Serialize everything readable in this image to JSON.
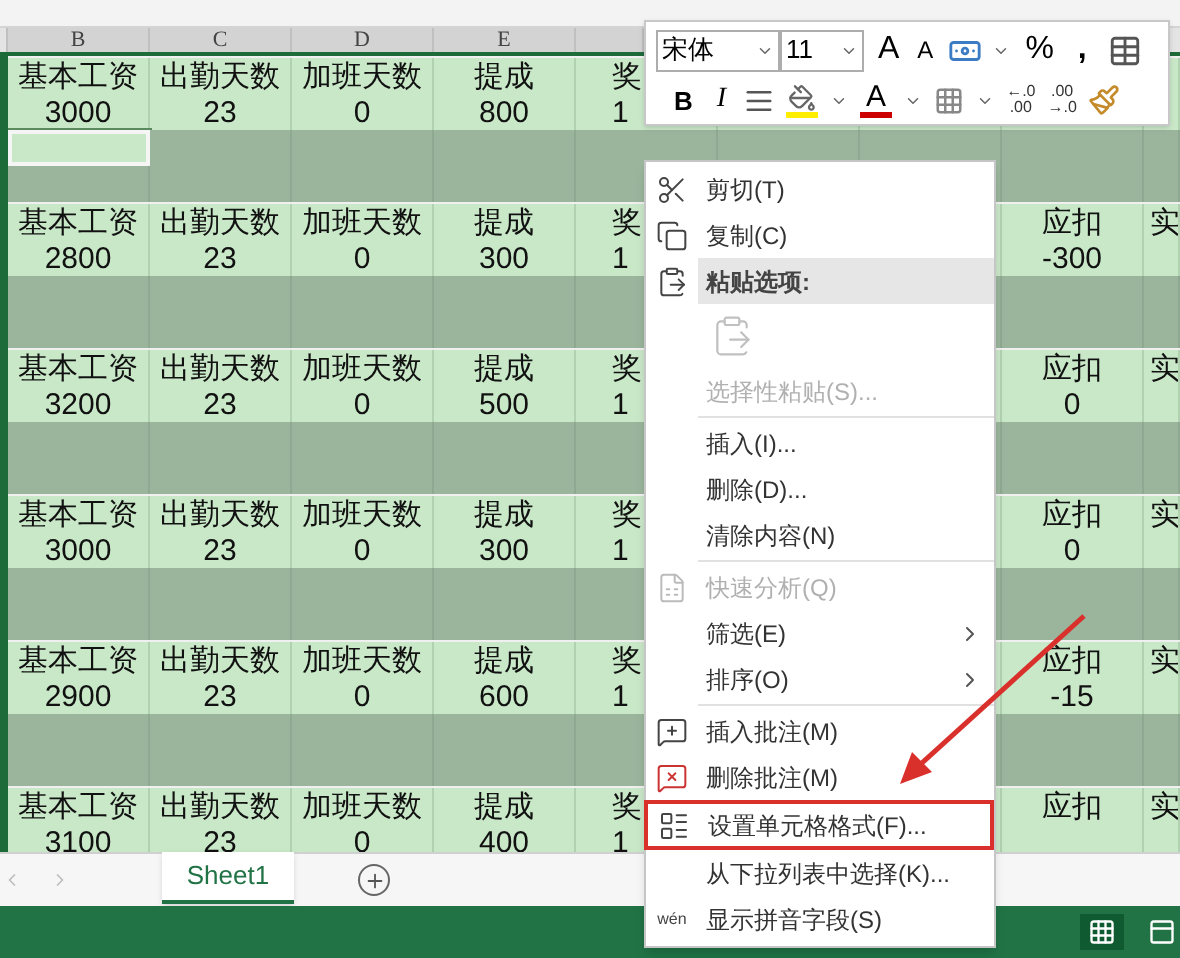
{
  "column_headers": [
    "B",
    "C",
    "D",
    "E"
  ],
  "blocks": [
    {
      "cells": [
        {
          "label": "基本工资",
          "value": "3000"
        },
        {
          "label": "出勤天数",
          "value": "23"
        },
        {
          "label": "加班天数",
          "value": "0"
        },
        {
          "label": "提成",
          "value": "800"
        },
        {
          "label": "奖",
          "value": "1"
        }
      ],
      "blank_selected": true
    },
    {
      "cells": [
        {
          "label": "基本工资",
          "value": "2800"
        },
        {
          "label": "出勤天数",
          "value": "23"
        },
        {
          "label": "加班天数",
          "value": "0"
        },
        {
          "label": "提成",
          "value": "300"
        },
        {
          "label": "奖",
          "value": "1"
        }
      ],
      "right_cells": [
        {
          "label": "应扣",
          "value": "-300"
        },
        {
          "label": "实"
        }
      ]
    },
    {
      "cells": [
        {
          "label": "基本工资",
          "value": "3200"
        },
        {
          "label": "出勤天数",
          "value": "23"
        },
        {
          "label": "加班天数",
          "value": "0"
        },
        {
          "label": "提成",
          "value": "500"
        },
        {
          "label": "奖",
          "value": "1"
        }
      ],
      "right_cells": [
        {
          "label": "应扣",
          "value": "0"
        },
        {
          "label": "实"
        }
      ]
    },
    {
      "cells": [
        {
          "label": "基本工资",
          "value": "3000"
        },
        {
          "label": "出勤天数",
          "value": "23"
        },
        {
          "label": "加班天数",
          "value": "0"
        },
        {
          "label": "提成",
          "value": "300"
        },
        {
          "label": "奖",
          "value": "1"
        }
      ],
      "right_cells": [
        {
          "label": "应扣",
          "value": "0"
        },
        {
          "label": "实"
        }
      ]
    },
    {
      "cells": [
        {
          "label": "基本工资",
          "value": "2900"
        },
        {
          "label": "出勤天数",
          "value": "23"
        },
        {
          "label": "加班天数",
          "value": "0"
        },
        {
          "label": "提成",
          "value": "600"
        },
        {
          "label": "奖",
          "value": "1"
        }
      ],
      "right_cells": [
        {
          "label": "应扣",
          "value": "-15"
        },
        {
          "label": "实"
        }
      ]
    },
    {
      "cells": [
        {
          "label": "基本工资",
          "value": "3100"
        },
        {
          "label": "出勤天数",
          "value": "23"
        },
        {
          "label": "加班天数",
          "value": "0"
        },
        {
          "label": "提成",
          "value": "400"
        },
        {
          "label": "奖",
          "value": "1"
        }
      ],
      "right_cells": [
        {
          "label": "应扣"
        },
        {
          "label": "实"
        }
      ]
    }
  ],
  "mini_toolbar": {
    "font_name": "宋体",
    "font_size": "11",
    "grow_glyph": "A",
    "shrink_glyph": "A",
    "percent": "%",
    "comma": ",",
    "bold": "B",
    "italic": "I",
    "font_color_glyph": "A",
    "increase_decimal": [
      "←.0",
      ".00"
    ],
    "decrease_decimal": [
      ".00",
      "→.0"
    ]
  },
  "context_menu": {
    "items": [
      {
        "kind": "item",
        "label": "剪切(T)",
        "disabled": false,
        "submenu": false,
        "annotated": false
      },
      {
        "kind": "item",
        "label": "复制(C)",
        "disabled": false,
        "submenu": false,
        "annotated": false
      },
      {
        "kind": "header",
        "label": "粘贴选项:"
      },
      {
        "kind": "paste_icon"
      },
      {
        "kind": "item",
        "label": "选择性粘贴(S)...",
        "disabled": true,
        "submenu": false,
        "annotated": false
      },
      {
        "kind": "separator"
      },
      {
        "kind": "item",
        "label": "插入(I)...",
        "disabled": false,
        "submenu": false,
        "annotated": false
      },
      {
        "kind": "item",
        "label": "删除(D)...",
        "disabled": false,
        "submenu": false,
        "annotated": false
      },
      {
        "kind": "item",
        "label": "清除内容(N)",
        "disabled": false,
        "submenu": false,
        "annotated": false
      },
      {
        "kind": "separator"
      },
      {
        "kind": "item",
        "label": "快速分析(Q)",
        "disabled": true,
        "submenu": false,
        "annotated": false
      },
      {
        "kind": "item",
        "label": "筛选(E)",
        "disabled": false,
        "submenu": true,
        "annotated": false
      },
      {
        "kind": "item",
        "label": "排序(O)",
        "disabled": false,
        "submenu": true,
        "annotated": false
      },
      {
        "kind": "separator"
      },
      {
        "kind": "item",
        "label": "插入批注(M)",
        "disabled": false,
        "submenu": false,
        "annotated": false
      },
      {
        "kind": "item",
        "label": "删除批注(M)",
        "disabled": false,
        "submenu": false,
        "annotated": false
      },
      {
        "kind": "item",
        "label": "设置单元格格式(F)...",
        "disabled": false,
        "submenu": false,
        "annotated": true
      },
      {
        "kind": "item",
        "label": "从下拉列表中选择(K)...",
        "disabled": false,
        "submenu": false,
        "annotated": false
      },
      {
        "kind": "item",
        "label": "显示拼音字段(S)",
        "icon_text": "wén",
        "disabled": false,
        "submenu": false,
        "annotated": false
      }
    ]
  },
  "sheet_tabs": [
    {
      "label": "Sheet1",
      "selected": true
    }
  ]
}
